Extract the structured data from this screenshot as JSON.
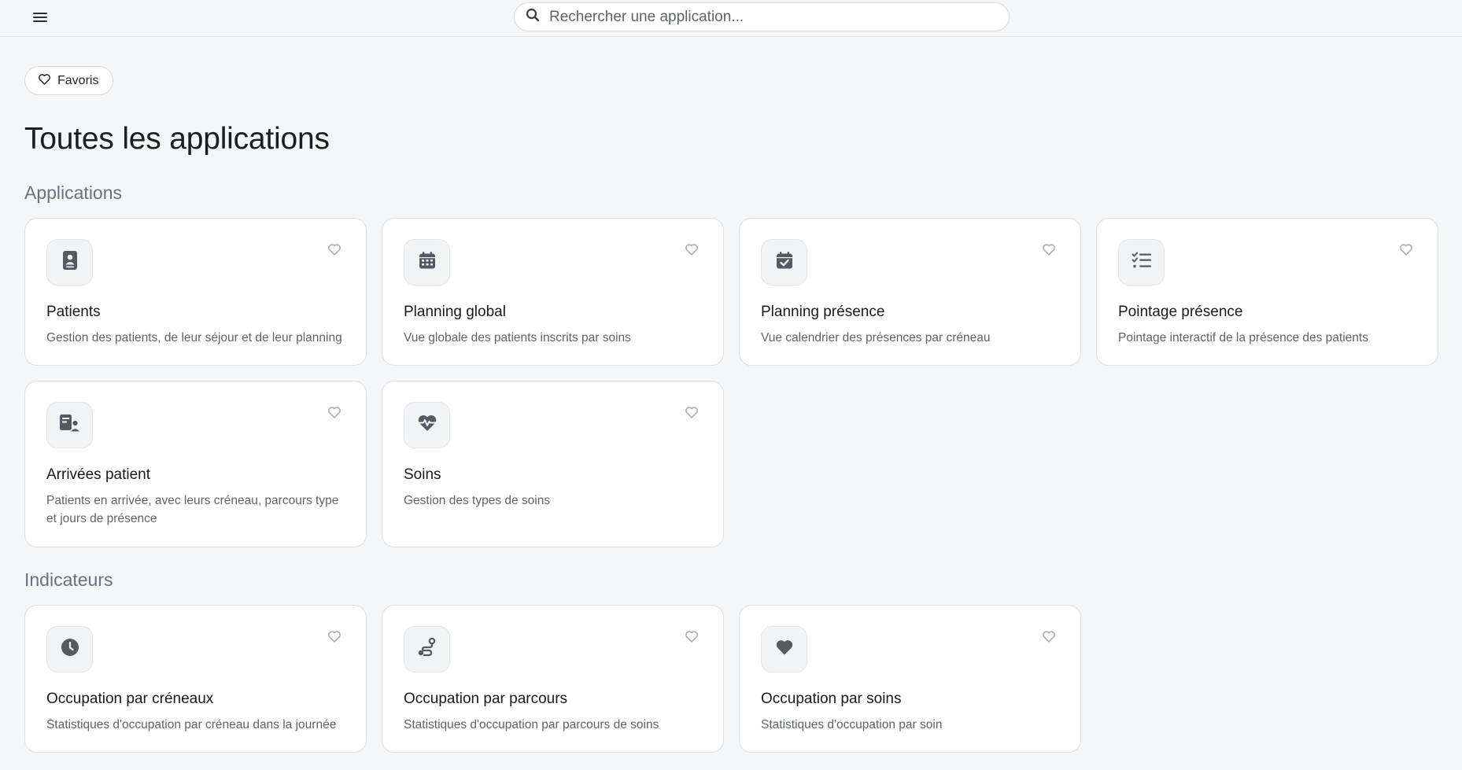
{
  "header": {
    "menu_icon": "hamburger-menu-icon",
    "search_placeholder": "Rechercher une application...",
    "search_value": ""
  },
  "favorites_button": {
    "label": "Favoris",
    "icon": "heart-outline-icon"
  },
  "page_title": "Toutes les applications",
  "sections": {
    "applications": {
      "title": "Applications",
      "cards": [
        {
          "title": "Patients",
          "description": "Gestion des patients, de leur séjour et de leur planning",
          "icon": "patient-id-card-icon"
        },
        {
          "title": "Planning global",
          "description": "Vue globale des patients inscrits par soins",
          "icon": "calendar-grid-icon"
        },
        {
          "title": "Planning présence",
          "description": "Vue calendrier des présences par créneau",
          "icon": "calendar-check-icon"
        },
        {
          "title": "Pointage présence",
          "description": "Pointage interactif de la présence des patients",
          "icon": "checklist-icon"
        },
        {
          "title": "Arrivées patient",
          "description": "Patients en arrivée, avec leurs créneau, parcours type et jours de présence",
          "icon": "patient-arrival-icon"
        },
        {
          "title": "Soins",
          "description": "Gestion des types de soins",
          "icon": "heart-pulse-icon"
        }
      ]
    },
    "indicators": {
      "title": "Indicateurs",
      "cards": [
        {
          "title": "Occupation par créneaux",
          "description": "Statistiques d'occupation par créneau dans la journée",
          "icon": "clock-icon"
        },
        {
          "title": "Occupation par parcours",
          "description": "Statistiques d'occupation par parcours de soins",
          "icon": "route-icon"
        },
        {
          "title": "Occupation par soins",
          "description": "Statistiques d'occupation par soin",
          "icon": "heart-filled-icon"
        }
      ]
    }
  },
  "colors": {
    "icon": "#555a60",
    "heart_outline": "#a9adb3",
    "background": "#f5f6f8"
  }
}
